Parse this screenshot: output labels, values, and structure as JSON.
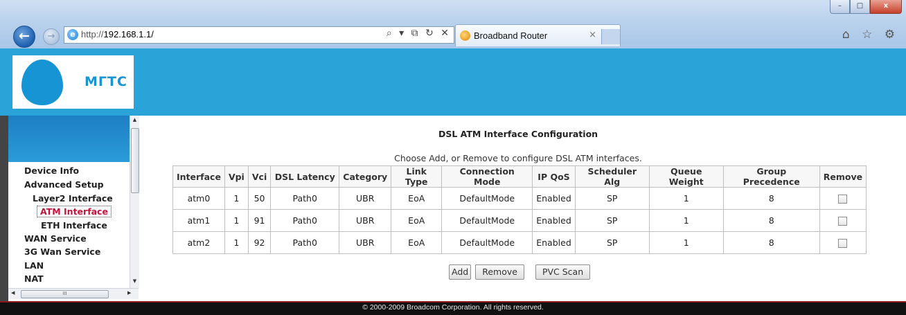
{
  "browser": {
    "window_buttons": {
      "minimize": "–",
      "maximize": "□",
      "close": "x"
    },
    "back_glyph": "←",
    "forward_glyph": "→",
    "url_prefix": "http://",
    "url_host": "192.168.1.1/",
    "address_tools": "⌕ ▾ ⧉ ↻ ✕",
    "tab_title": "Broadband Router",
    "tab_close": "×",
    "toolbar_icons": "⌂ ☆ ⚙"
  },
  "header": {
    "logo_text": "МГТС"
  },
  "menu": {
    "items": [
      {
        "label": "Device Info",
        "level": 1
      },
      {
        "label": "Advanced Setup",
        "level": 1
      },
      {
        "label": "Layer2 Interface",
        "level": 2
      },
      {
        "label": "ATM Interface",
        "level": 3,
        "active": true
      },
      {
        "label": "ETH Interface",
        "level": 3
      },
      {
        "label": "WAN Service",
        "level": 2
      },
      {
        "label": "3G Wan Service",
        "level": 2
      },
      {
        "label": "LAN",
        "level": 2
      },
      {
        "label": "NAT",
        "level": 2
      }
    ],
    "scroll_grip": "III"
  },
  "page": {
    "title": "DSL ATM Interface Configuration",
    "subtitle": "Choose Add, or Remove to configure DSL ATM interfaces."
  },
  "table": {
    "columns": [
      "Interface",
      "Vpi",
      "Vci",
      "DSL Latency",
      "Category",
      "Link Type",
      "Connection Mode",
      "IP QoS",
      "Scheduler Alg",
      "Queue Weight",
      "Group Precedence",
      "Remove"
    ],
    "rows": [
      [
        "atm0",
        "1",
        "50",
        "Path0",
        "UBR",
        "EoA",
        "DefaultMode",
        "Enabled",
        "SP",
        "1",
        "8"
      ],
      [
        "atm1",
        "1",
        "91",
        "Path0",
        "UBR",
        "EoA",
        "DefaultMode",
        "Enabled",
        "SP",
        "1",
        "8"
      ],
      [
        "atm2",
        "1",
        "92",
        "Path0",
        "UBR",
        "EoA",
        "DefaultMode",
        "Enabled",
        "SP",
        "1",
        "8"
      ]
    ]
  },
  "buttons": {
    "add": "Add",
    "remove": "Remove",
    "pvc_scan": "PVC Scan"
  },
  "footer": {
    "copyright": "© 2000-2009 Broadcom Corporation. All rights reserved."
  },
  "colors": {
    "header_blue": "#29a3d8",
    "brand_blue": "#1794d3",
    "active_menu": "#c0143c",
    "footer_bg": "#111111"
  }
}
